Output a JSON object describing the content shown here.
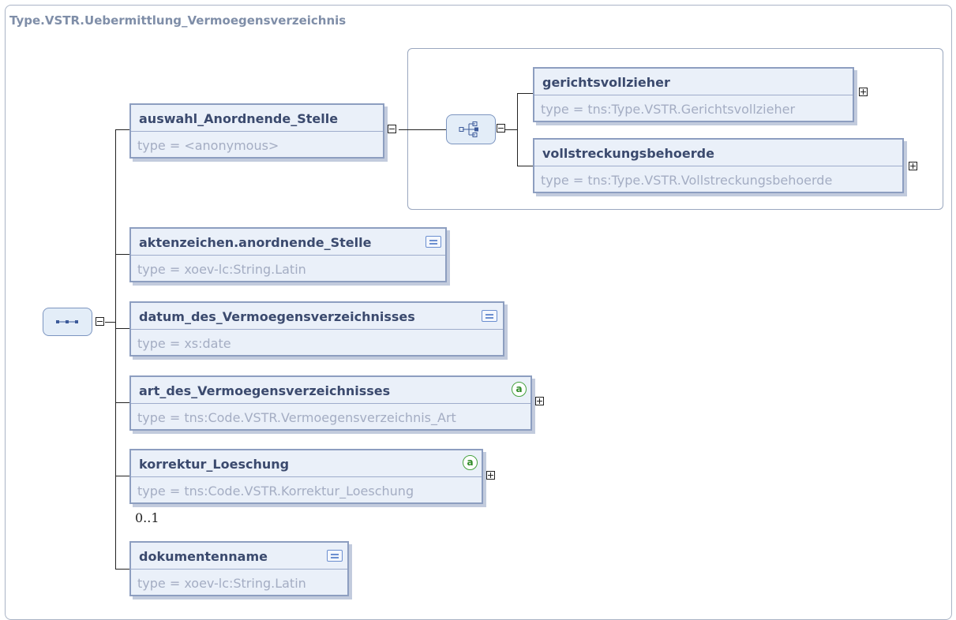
{
  "diagram": {
    "title": "Type.VSTR.Uebermittlung_Vermoegensverzeichnis",
    "choice_elements": [
      {
        "name": "gerichtsvollzieher",
        "type": "type = tns:Type.VSTR.Gerichtsvollzieher"
      },
      {
        "name": "vollstreckungsbehoerde",
        "type": "type = tns:Type.VSTR.Vollstreckungsbehoerde"
      }
    ],
    "elements": [
      {
        "name": "auswahl_Anordnende_Stelle",
        "type": "type = <anonymous>"
      },
      {
        "name": "aktenzeichen.anordnende_Stelle",
        "type": "type = xoev-lc:String.Latin",
        "icon": "documentation-icon"
      },
      {
        "name": "datum_des_Vermoegensverzeichnisses",
        "type": "type = xs:date",
        "icon": "documentation-icon"
      },
      {
        "name": "art_des_Vermoegensverzeichnisses",
        "type": "type = tns:Code.VSTR.Vermoegensverzeichnis_Art",
        "icon": "attribute-icon"
      },
      {
        "name": "korrektur_Loeschung",
        "type": "type = tns:Code.VSTR.Korrektur_Loeschung",
        "icon": "attribute-icon",
        "occurrence": "0..1"
      },
      {
        "name": "dokumentenname",
        "type": "type = xoev-lc:String.Latin",
        "icon": "documentation-icon"
      }
    ],
    "attribute_glyph": "a"
  }
}
